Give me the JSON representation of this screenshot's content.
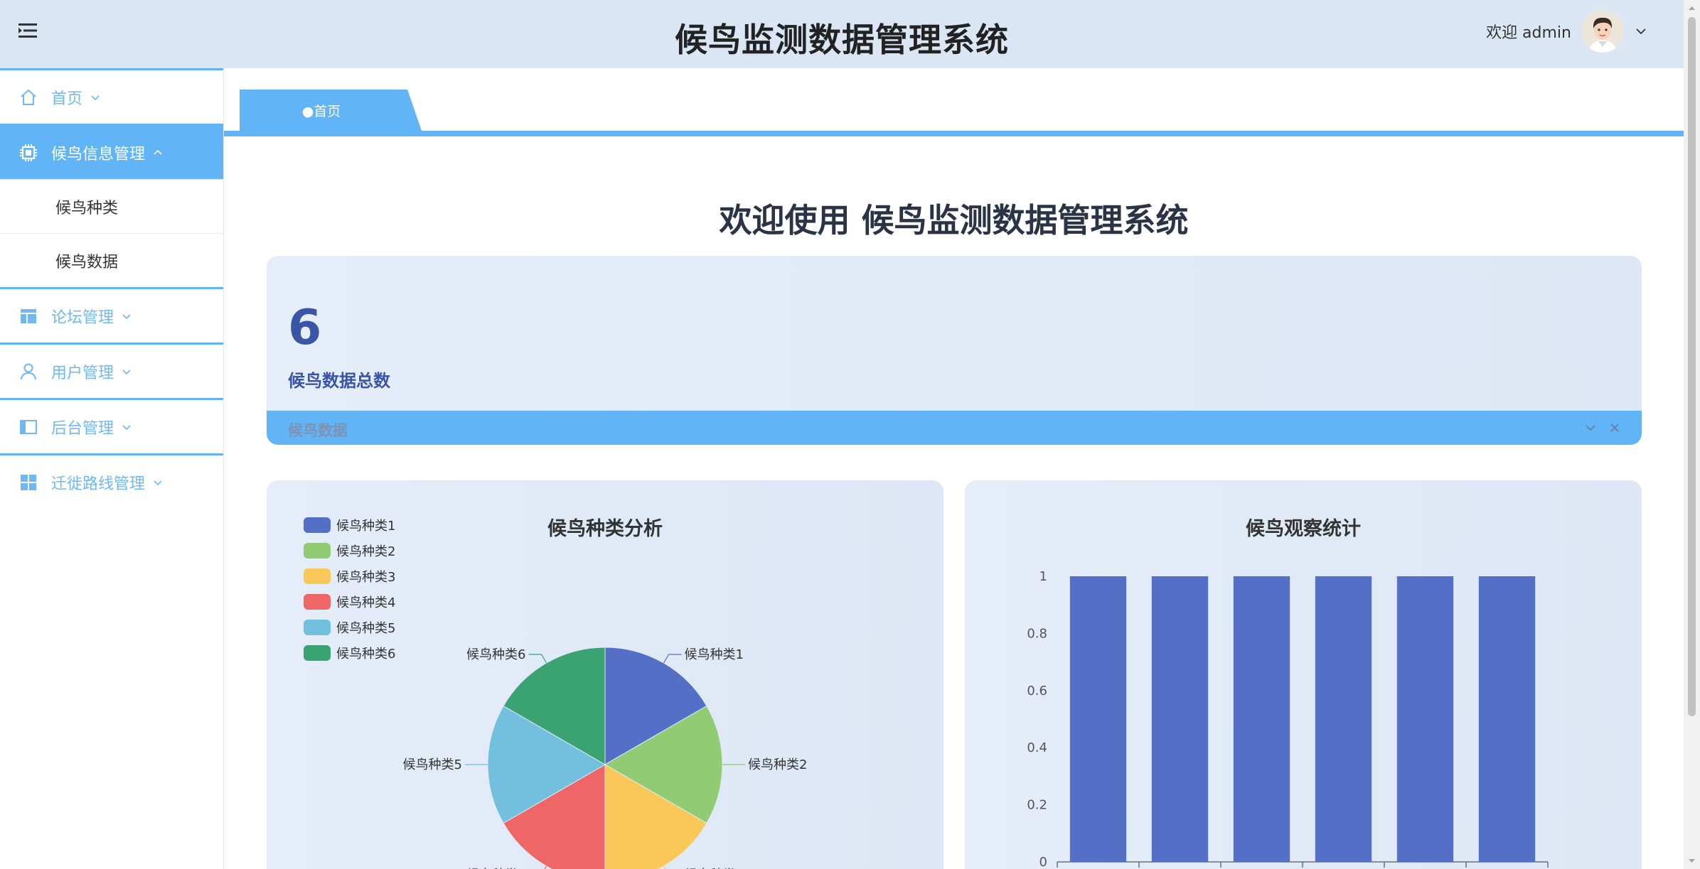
{
  "header": {
    "title": "候鸟监测数据管理系统",
    "welcome": "欢迎 admin"
  },
  "sidebar": {
    "items": [
      {
        "label": "首页",
        "icon": "home-icon",
        "expanded": false
      },
      {
        "label": "候鸟信息管理",
        "icon": "chip-icon",
        "expanded": true,
        "children": [
          "候鸟种类",
          "候鸟数据"
        ]
      },
      {
        "label": "论坛管理",
        "icon": "layout-icon",
        "expanded": false
      },
      {
        "label": "用户管理",
        "icon": "user-icon",
        "expanded": false
      },
      {
        "label": "后台管理",
        "icon": "panel-icon",
        "expanded": false
      },
      {
        "label": "迁徙路线管理",
        "icon": "grid-icon",
        "expanded": false
      }
    ]
  },
  "tabs": [
    {
      "label": "●首页",
      "active": true
    }
  ],
  "main": {
    "welcome_heading": "欢迎使用 候鸟监测数据管理系统",
    "stat": {
      "value": "6",
      "label": "候鸟数据总数",
      "bar_label": "候鸟数据"
    }
  },
  "colors": {
    "accent": "#61b4f6",
    "header_bg": "#dbe6f5",
    "stat_text": "#3a55a5"
  },
  "chart_data": [
    {
      "type": "pie",
      "title": "候鸟种类分析",
      "legend_position": "top-left",
      "categories": [
        "候鸟种类1",
        "候鸟种类2",
        "候鸟种类3",
        "候鸟种类4",
        "候鸟种类5",
        "候鸟种类6"
      ],
      "values": [
        1,
        1,
        1,
        1,
        1,
        1
      ],
      "colors": [
        "#5470c6",
        "#91cc75",
        "#fac858",
        "#ee6666",
        "#73c0de",
        "#3ba272"
      ]
    },
    {
      "type": "bar",
      "title": "候鸟观察统计",
      "values": [
        1,
        1,
        1,
        1,
        1,
        1
      ],
      "ylim": [
        0,
        1
      ],
      "yticks": [
        "0",
        "0.2",
        "0.4",
        "0.6",
        "0.8",
        "1"
      ],
      "color": "#5470c6",
      "grid": false
    }
  ]
}
